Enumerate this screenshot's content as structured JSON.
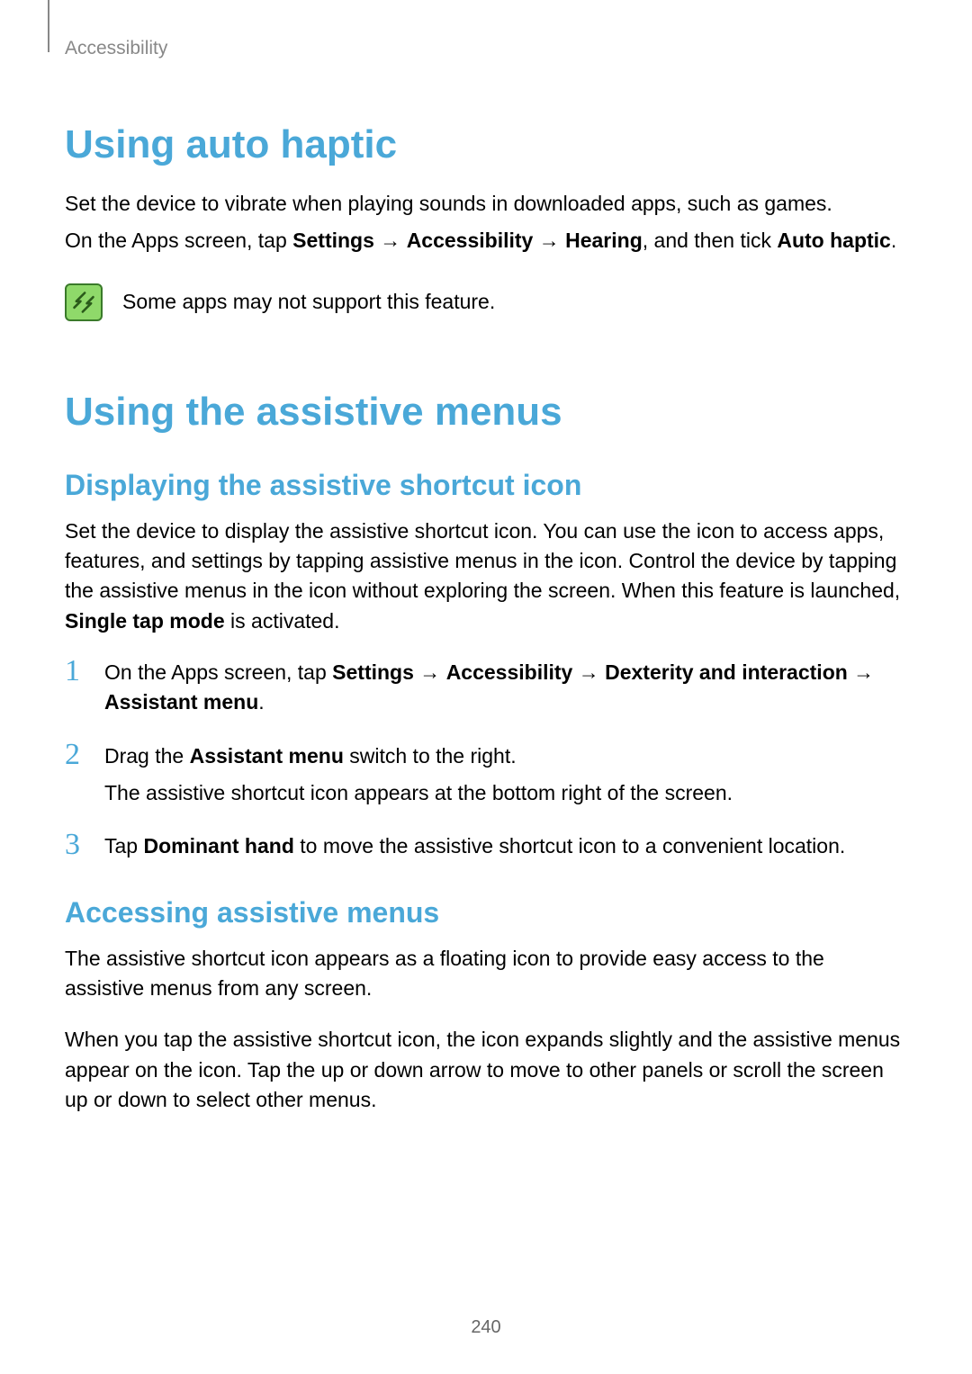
{
  "breadcrumb": "Accessibility",
  "section1": {
    "title": "Using auto haptic",
    "p1": "Set the device to vibrate when playing sounds in downloaded apps, such as games.",
    "p2_a": "On the Apps screen, tap ",
    "p2_b1": "Settings",
    "p2_arrow": " → ",
    "p2_b2": "Accessibility",
    "p2_b3": "Hearing",
    "p2_c": ", and then tick ",
    "p2_b4": "Auto haptic",
    "p2_d": ".",
    "note": "Some apps may not support this feature."
  },
  "section2": {
    "title": "Using the assistive menus",
    "sub1": {
      "title": "Displaying the assistive shortcut icon",
      "p1_a": "Set the device to display the assistive shortcut icon. You can use the icon to access apps, features, and settings by tapping assistive menus in the icon. Control the device by tapping the assistive menus in the icon without exploring the screen. When this feature is launched, ",
      "p1_b": "Single tap mode",
      "p1_c": " is activated.",
      "step1": {
        "num": "1",
        "a": "On the Apps screen, tap ",
        "b1": "Settings",
        "arrow": " → ",
        "b2": "Accessibility",
        "b3": "Dexterity and interaction",
        "b4": "Assistant menu",
        "d": "."
      },
      "step2": {
        "num": "2",
        "a": "Drag the ",
        "b1": "Assistant menu",
        "c": " switch to the right.",
        "sub": "The assistive shortcut icon appears at the bottom right of the screen."
      },
      "step3": {
        "num": "3",
        "a": "Tap ",
        "b1": "Dominant hand",
        "c": " to move the assistive shortcut icon to a convenient location."
      }
    },
    "sub2": {
      "title": "Accessing assistive menus",
      "p1": "The assistive shortcut icon appears as a floating icon to provide easy access to the assistive menus from any screen.",
      "p2": "When you tap the assistive shortcut icon, the icon expands slightly and the assistive menus appear on the icon. Tap the up or down arrow to move to other panels or scroll the screen up or down to select other menus."
    }
  },
  "page_number": "240"
}
